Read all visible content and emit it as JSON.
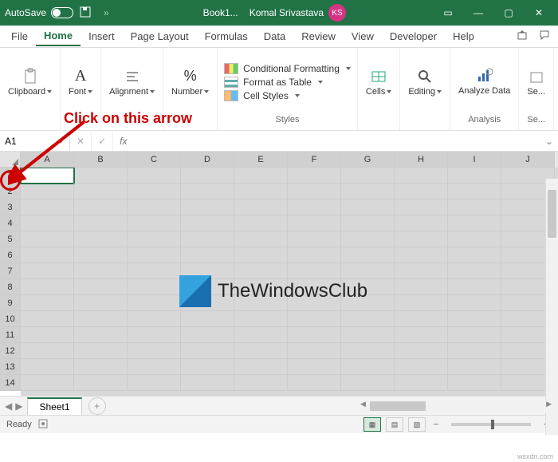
{
  "title": {
    "autosave": "AutoSave",
    "filename": "Book1...",
    "username": "Komal Srivastava",
    "initials": "KS"
  },
  "menu": {
    "file": "File",
    "home": "Home",
    "insert": "Insert",
    "pagelayout": "Page Layout",
    "formulas": "Formulas",
    "data": "Data",
    "review": "Review",
    "view": "View",
    "developer": "Developer",
    "help": "Help"
  },
  "ribbon": {
    "clipboard": "Clipboard",
    "font": "Font",
    "alignment": "Alignment",
    "number": "Number",
    "styles": "Styles",
    "cond_fmt": "Conditional Formatting",
    "fmt_table": "Format as Table",
    "cell_styles": "Cell Styles",
    "cells": "Cells",
    "editing": "Editing",
    "analyze": "Analyze Data",
    "analysis": "Analysis",
    "sensitivity_short": "Se...",
    "sensitivity_group": "Se..."
  },
  "annotation": "Click on this arrow",
  "namebox": "A1",
  "fx": "fx",
  "columns": [
    "A",
    "B",
    "C",
    "D",
    "E",
    "F",
    "G",
    "H",
    "I",
    "J"
  ],
  "rows": [
    "1",
    "2",
    "3",
    "4",
    "5",
    "6",
    "7",
    "8",
    "9",
    "10",
    "11",
    "12",
    "13",
    "14"
  ],
  "watermark": "TheWindowsClub",
  "sheet": {
    "tab1": "Sheet1",
    "add": "+"
  },
  "status": {
    "ready": "Ready",
    "zoom_minus": "−",
    "zoom_plus": "+"
  },
  "credit": "wsxdn.com",
  "chevrons": "»"
}
